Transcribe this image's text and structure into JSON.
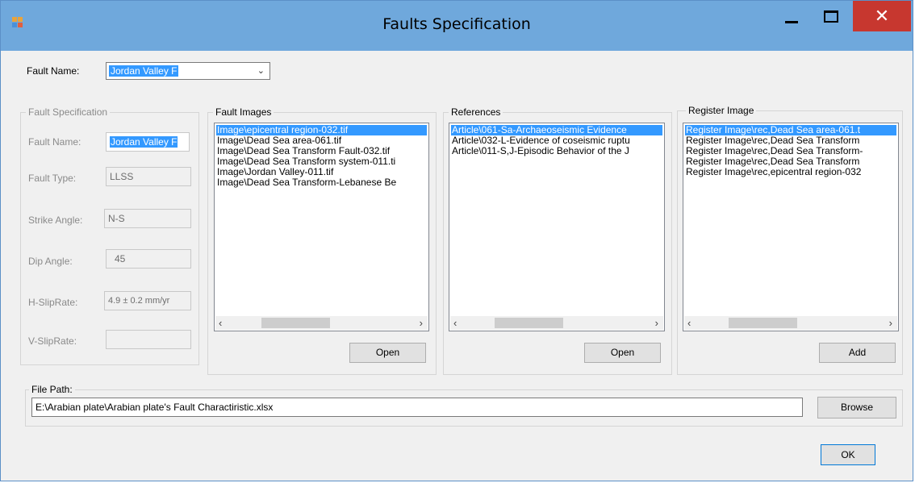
{
  "window": {
    "title": "Faults Specification",
    "close_glyph": "✕"
  },
  "fault_name": {
    "label": "Fault Name:",
    "value": "Jordan Valley F"
  },
  "spec": {
    "title": "Fault Specification",
    "fault_name_label": "Fault Name:",
    "fault_name_value": "Jordan Valley F",
    "fault_type_label": "Fault Type:",
    "fault_type_value": "LLSS",
    "strike_label": "Strike Angle:",
    "strike_value": "N-S",
    "dip_label": "Dip Angle:",
    "dip_value": "45",
    "hslip_label": "H-SlipRate:",
    "hslip_value": "4.9 ± 0.2 mm/yr",
    "vslip_label": "V-SlipRate:",
    "vslip_value": ""
  },
  "images": {
    "title": "Fault Images",
    "items": [
      "Image\\epicentral region-032.tif",
      "Image\\Dead Sea area-061.tif",
      "Image\\Dead Sea Transform Fault-032.tif",
      "Image\\Dead Sea Transform system-011.ti",
      "Image\\Jordan Valley-011.tif",
      "Image\\Dead Sea Transform-Lebanese Be"
    ],
    "open_label": "Open"
  },
  "references": {
    "title": "References",
    "items": [
      "Article\\061-Sa-Archaeoseismic Evidence",
      "Article\\032-L-Evidence of coseismic ruptu",
      "Article\\011-S,J-Episodic Behavior of the J"
    ],
    "open_label": "Open"
  },
  "register": {
    "title": "Register Image",
    "items": [
      "Register Image\\rec,Dead Sea area-061.t",
      "Register Image\\rec,Dead Sea Transform",
      "Register Image\\rec,Dead Sea Transform-",
      "Register Image\\rec,Dead Sea Transform",
      "Register Image\\rec,epicentral region-032"
    ],
    "add_label": "Add"
  },
  "file_path": {
    "title": "File Path:",
    "value": "E:\\Arabian plate\\Arabian plate's Fault Charactiristic.xlsx",
    "browse_label": "Browse"
  },
  "ok_label": "OK",
  "colors": {
    "titlebar": "#6fa8dc",
    "close": "#c7372f",
    "selection": "#3399ff"
  }
}
